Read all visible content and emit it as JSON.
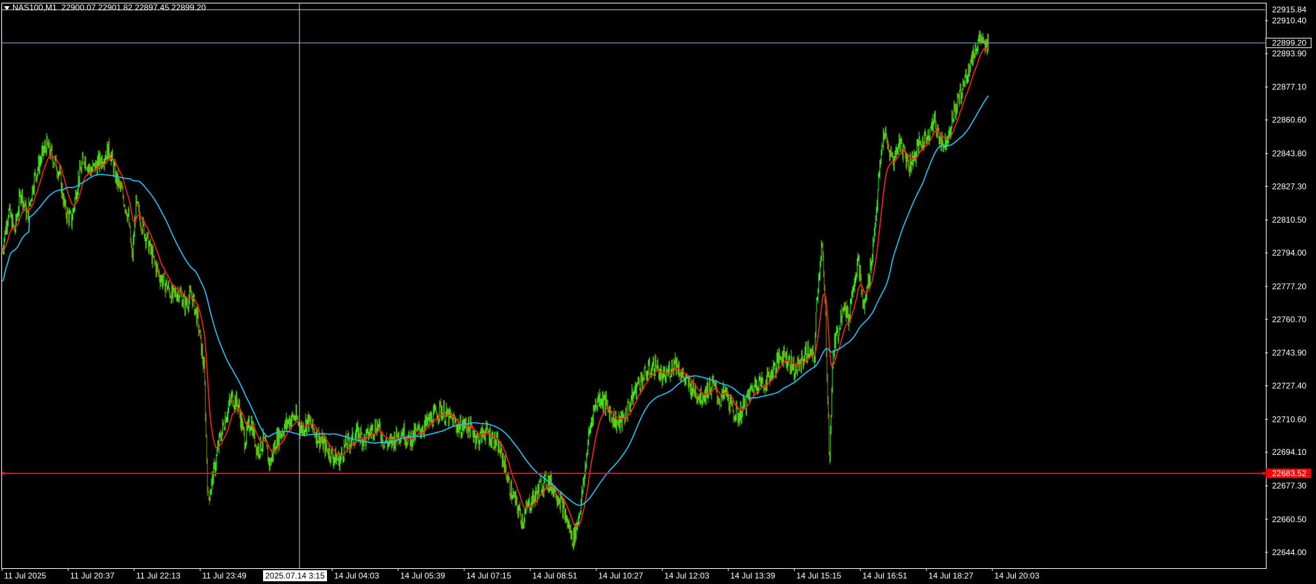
{
  "symbol": {
    "name": "NAS100,M1",
    "open": "22900.07",
    "high": "22901.82",
    "low": "22897.45",
    "close": "22899.20"
  },
  "crosshair": {
    "time_label": "2025.07.14 3:15"
  },
  "price_axis": {
    "min": 22636,
    "max": 22919,
    "ticks": [
      "22910.40",
      "22893.90",
      "22877.10",
      "22860.60",
      "22843.80",
      "22827.30",
      "22810.50",
      "22794.00",
      "22777.20",
      "22760.70",
      "22743.90",
      "22727.40",
      "22710.60",
      "22694.10",
      "22677.30",
      "22660.50",
      "22644.00"
    ],
    "tick_values": [
      22910.4,
      22893.9,
      22877.1,
      22860.6,
      22843.8,
      22827.3,
      22810.5,
      22794.0,
      22777.2,
      22760.7,
      22743.9,
      22727.4,
      22710.6,
      22694.1,
      22677.3,
      22660.5,
      22644.0
    ],
    "top_label": "22915.84",
    "top_value": 22915.84
  },
  "current_price_line": {
    "label": "22899.20",
    "value": 22899.2,
    "color": "#8aa6c8"
  },
  "horizontal_level": {
    "label": "22683.52",
    "value": 22683.52,
    "color": "#ff0000"
  },
  "time_axis": {
    "ticks": [
      "11 Jul 2025",
      "11 Jul 20:37",
      "11 Jul 22:13",
      "11 Jul 23:49",
      "14 Jul 04:03",
      "14 Jul 05:39",
      "14 Jul 07:15",
      "14 Jul 08:51",
      "14 Jul 10:27",
      "14 Jul 12:03",
      "14 Jul 13:39",
      "14 Jul 15:15",
      "14 Jul 16:51",
      "14 Jul 18:27",
      "14 Jul 20:03"
    ],
    "tick_positions": [
      0,
      0.0523,
      0.1045,
      0.1568,
      0.2613,
      0.3136,
      0.3659,
      0.4182,
      0.4704,
      0.5227,
      0.5749,
      0.6272,
      0.6795,
      0.7318,
      0.784
    ]
  },
  "chart_data": {
    "type": "line",
    "series": [],
    "price_path": [
      [
        0.0,
        22795
      ],
      [
        0.005,
        22815
      ],
      [
        0.01,
        22805
      ],
      [
        0.015,
        22825
      ],
      [
        0.02,
        22812
      ],
      [
        0.025,
        22830
      ],
      [
        0.03,
        22840
      ],
      [
        0.035,
        22848
      ],
      [
        0.04,
        22842
      ],
      [
        0.045,
        22835
      ],
      [
        0.05,
        22815
      ],
      [
        0.055,
        22810
      ],
      [
        0.06,
        22830
      ],
      [
        0.065,
        22842
      ],
      [
        0.07,
        22835
      ],
      [
        0.075,
        22838
      ],
      [
        0.08,
        22842
      ],
      [
        0.085,
        22846
      ],
      [
        0.09,
        22832
      ],
      [
        0.095,
        22824
      ],
      [
        0.1,
        22812
      ],
      [
        0.103,
        22790
      ],
      [
        0.106,
        22818
      ],
      [
        0.11,
        22810
      ],
      [
        0.115,
        22800
      ],
      [
        0.12,
        22790
      ],
      [
        0.125,
        22782
      ],
      [
        0.13,
        22778
      ],
      [
        0.135,
        22772
      ],
      [
        0.14,
        22775
      ],
      [
        0.145,
        22768
      ],
      [
        0.15,
        22773
      ],
      [
        0.155,
        22760
      ],
      [
        0.16,
        22735
      ],
      [
        0.163,
        22670
      ],
      [
        0.168,
        22685
      ],
      [
        0.172,
        22700
      ],
      [
        0.177,
        22712
      ],
      [
        0.182,
        22722
      ],
      [
        0.187,
        22718
      ],
      [
        0.192,
        22700
      ],
      [
        0.197,
        22710
      ],
      [
        0.202,
        22695
      ],
      [
        0.207,
        22700
      ],
      [
        0.212,
        22688
      ],
      [
        0.217,
        22700
      ],
      [
        0.222,
        22705
      ],
      [
        0.227,
        22710
      ],
      [
        0.232,
        22712
      ],
      [
        0.237,
        22706
      ],
      [
        0.242,
        22710
      ],
      [
        0.247,
        22705
      ],
      [
        0.252,
        22700
      ],
      [
        0.257,
        22696
      ],
      [
        0.262,
        22692
      ],
      [
        0.267,
        22690
      ],
      [
        0.272,
        22698
      ],
      [
        0.277,
        22700
      ],
      [
        0.282,
        22704
      ],
      [
        0.287,
        22700
      ],
      [
        0.292,
        22705
      ],
      [
        0.297,
        22708
      ],
      [
        0.302,
        22700
      ],
      [
        0.307,
        22698
      ],
      [
        0.312,
        22702
      ],
      [
        0.317,
        22705
      ],
      [
        0.322,
        22700
      ],
      [
        0.327,
        22703
      ],
      [
        0.332,
        22706
      ],
      [
        0.337,
        22709
      ],
      [
        0.342,
        22712
      ],
      [
        0.347,
        22716
      ],
      [
        0.352,
        22712
      ],
      [
        0.357,
        22710
      ],
      [
        0.362,
        22706
      ],
      [
        0.367,
        22708
      ],
      [
        0.372,
        22705
      ],
      [
        0.377,
        22700
      ],
      [
        0.382,
        22705
      ],
      [
        0.387,
        22702
      ],
      [
        0.392,
        22698
      ],
      [
        0.397,
        22690
      ],
      [
        0.402,
        22676
      ],
      [
        0.407,
        22668
      ],
      [
        0.412,
        22660
      ],
      [
        0.417,
        22668
      ],
      [
        0.422,
        22672
      ],
      [
        0.427,
        22678
      ],
      [
        0.432,
        22680
      ],
      [
        0.437,
        22676
      ],
      [
        0.442,
        22670
      ],
      [
        0.447,
        22660
      ],
      [
        0.452,
        22650
      ],
      [
        0.456,
        22660
      ],
      [
        0.46,
        22676
      ],
      [
        0.464,
        22700
      ],
      [
        0.468,
        22715
      ],
      [
        0.473,
        22722
      ],
      [
        0.478,
        22718
      ],
      [
        0.483,
        22712
      ],
      [
        0.488,
        22708
      ],
      [
        0.493,
        22712
      ],
      [
        0.498,
        22720
      ],
      [
        0.503,
        22728
      ],
      [
        0.508,
        22732
      ],
      [
        0.513,
        22736
      ],
      [
        0.518,
        22738
      ],
      [
        0.523,
        22730
      ],
      [
        0.528,
        22735
      ],
      [
        0.533,
        22740
      ],
      [
        0.538,
        22733
      ],
      [
        0.543,
        22728
      ],
      [
        0.548,
        22725
      ],
      [
        0.553,
        22722
      ],
      [
        0.558,
        22725
      ],
      [
        0.563,
        22728
      ],
      [
        0.568,
        22720
      ],
      [
        0.573,
        22724
      ],
      [
        0.578,
        22715
      ],
      [
        0.583,
        22712
      ],
      [
        0.588,
        22718
      ],
      [
        0.593,
        22725
      ],
      [
        0.598,
        22730
      ],
      [
        0.603,
        22728
      ],
      [
        0.608,
        22733
      ],
      [
        0.613,
        22738
      ],
      [
        0.618,
        22744
      ],
      [
        0.623,
        22740
      ],
      [
        0.628,
        22735
      ],
      [
        0.633,
        22740
      ],
      [
        0.638,
        22745
      ],
      [
        0.643,
        22740
      ],
      [
        0.645,
        22770
      ],
      [
        0.649,
        22800
      ],
      [
        0.652,
        22760
      ],
      [
        0.655,
        22690
      ],
      [
        0.658,
        22745
      ],
      [
        0.662,
        22755
      ],
      [
        0.666,
        22770
      ],
      [
        0.67,
        22760
      ],
      [
        0.674,
        22780
      ],
      [
        0.678,
        22790
      ],
      [
        0.682,
        22765
      ],
      [
        0.686,
        22780
      ],
      [
        0.69,
        22800
      ],
      [
        0.694,
        22830
      ],
      [
        0.698,
        22855
      ],
      [
        0.702,
        22845
      ],
      [
        0.706,
        22840
      ],
      [
        0.71,
        22850
      ],
      [
        0.714,
        22845
      ],
      [
        0.718,
        22838
      ],
      [
        0.722,
        22842
      ],
      [
        0.726,
        22848
      ],
      [
        0.73,
        22850
      ],
      [
        0.734,
        22855
      ],
      [
        0.738,
        22860
      ],
      [
        0.742,
        22852
      ],
      [
        0.746,
        22848
      ],
      [
        0.75,
        22856
      ],
      [
        0.754,
        22865
      ],
      [
        0.758,
        22872
      ],
      [
        0.762,
        22880
      ],
      [
        0.766,
        22888
      ],
      [
        0.77,
        22895
      ],
      [
        0.774,
        22902
      ],
      [
        0.778,
        22896
      ],
      [
        0.781,
        22899
      ]
    ],
    "ma_fast_color": "#ff2020",
    "ma_slow_color": "#1ec8ff",
    "candle_up_color": "#22ff22",
    "candle_wick_color": "#8c8c00"
  }
}
